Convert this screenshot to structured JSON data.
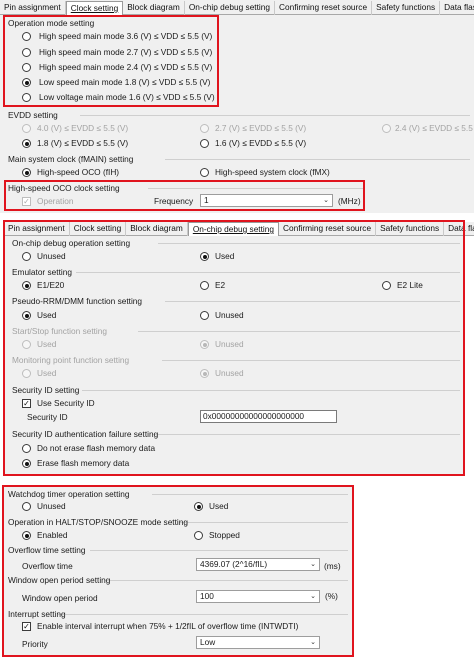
{
  "tabs_top": [
    "Pin assignment",
    "Clock setting",
    "Block diagram",
    "On-chip debug setting",
    "Confirming reset source",
    "Safety functions",
    "Data flash"
  ],
  "tabs_mid": [
    "Pin assignment",
    "Clock setting",
    "Block diagram",
    "On-chip debug setting",
    "Confirming reset source",
    "Safety functions",
    "Data flash"
  ],
  "clock": {
    "op_mode_title": "Operation mode setting",
    "op_modes": [
      {
        "label": "High speed main mode 3.6 (V) ≤ VDD ≤ 5.5 (V)",
        "selected": false
      },
      {
        "label": "High speed main mode 2.7 (V) ≤ VDD ≤ 5.5 (V)",
        "selected": false
      },
      {
        "label": "High speed main mode 2.4 (V) ≤ VDD ≤ 5.5 (V)",
        "selected": false
      },
      {
        "label": "Low speed main mode 1.8 (V) ≤ VDD ≤ 5.5 (V)",
        "selected": true
      },
      {
        "label": "Low voltage main mode 1.6 (V) ≤ VDD ≤ 5.5 (V)",
        "selected": false
      }
    ],
    "evdd_title": "EVDD setting",
    "evdd_row1": [
      "4.0 (V) ≤ EVDD ≤ 5.5 (V)",
      "2.7 (V) ≤ EVDD ≤ 5.5 (V)",
      "2.4 (V) ≤ EVDD ≤ 5.5 (V)"
    ],
    "evdd_row2": [
      "1.8 (V) ≤ EVDD ≤ 5.5 (V)",
      "1.6 (V) ≤ EVDD ≤ 5.5 (V)"
    ],
    "main_clock_title": "Main system clock (fMAIN) setting",
    "main_clock_opts": [
      "High-speed OCO (fIH)",
      "High-speed system clock (fMX)"
    ],
    "oco_title": "High-speed OCO clock setting",
    "oco_operation": "Operation",
    "frequency_label": "Frequency",
    "frequency_value": "1",
    "frequency_unit": "(MHz)"
  },
  "debug": {
    "ocd_title": "On-chip debug operation setting",
    "ocd_opts": [
      "Unused",
      "Used"
    ],
    "emu_title": "Emulator setting",
    "emu_opts": [
      "E1/E20",
      "E2",
      "E2 Lite"
    ],
    "pseudo_title": "Pseudo-RRM/DMM function setting",
    "pseudo_opts": [
      "Used",
      "Unused"
    ],
    "startstop_title": "Start/Stop function setting",
    "startstop_opts": [
      "Used",
      "Unused"
    ],
    "monitor_title": "Monitoring point function setting",
    "monitor_opts": [
      "Used",
      "Unused"
    ],
    "secid_title": "Security ID setting",
    "use_secid": "Use Security ID",
    "secid_label": "Security ID",
    "secid_value": "0x00000000000000000000",
    "secfail_title": "Security ID authentication failure setting",
    "secfail_opts": [
      "Do not erase flash memory data",
      "Erase flash memory data"
    ]
  },
  "wdt": {
    "wdt_title": "Watchdog timer operation setting",
    "wdt_opts": [
      "Unused",
      "Used"
    ],
    "halt_title": "Operation in HALT/STOP/SNOOZE mode setting",
    "halt_opts": [
      "Enabled",
      "Stopped"
    ],
    "overflow_title": "Overflow time setting",
    "overflow_label": "Overflow time",
    "overflow_value": "4369.07 (2^16/fIL)",
    "overflow_unit": "(ms)",
    "window_title": "Window open period setting",
    "window_label": "Window open period",
    "window_value": "100",
    "window_unit": "(%)",
    "interrupt_title": "Interrupt setting",
    "interrupt_check": "Enable interval interrupt when 75% + 1/2fIL of overflow time (INTWDTI)",
    "priority_label": "Priority",
    "priority_value": "Low"
  }
}
